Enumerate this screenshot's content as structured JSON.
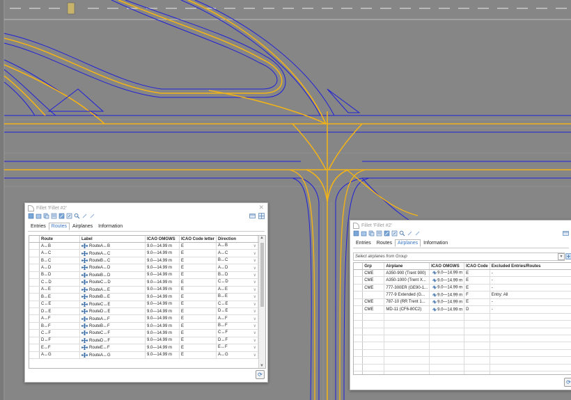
{
  "colors": {
    "background": "#868686",
    "taxiway_centerline": "#f2b318",
    "taxiway_edge": "#1f1fd8",
    "accent": "#3a76c4"
  },
  "dialog_routes": {
    "title": "Fillet 'Fillet #2'",
    "tabs": [
      "Entries",
      "Routes",
      "Airplanes",
      "Information"
    ],
    "active_tab": "Routes",
    "columns": {
      "route": "Route",
      "label": "Label",
      "omgws": "ICAO OMGWS",
      "code": "ICAO Code letter",
      "direction": "Direction"
    },
    "rows": [
      {
        "route": "A↔B",
        "label": "RouteA↔B",
        "omgws": "9.0—14.99 m",
        "code": "E",
        "direction": "A↔B"
      },
      {
        "route": "A↔C",
        "label": "RouteA↔C",
        "omgws": "9.0—14.99 m",
        "code": "E",
        "direction": "A↔C"
      },
      {
        "route": "B↔C",
        "label": "RouteB↔C",
        "omgws": "9.0—14.99 m",
        "code": "E",
        "direction": "B↔C"
      },
      {
        "route": "A↔D",
        "label": "RouteA↔D",
        "omgws": "9.0—14.99 m",
        "code": "E",
        "direction": "A↔D"
      },
      {
        "route": "B↔D",
        "label": "RouteB↔D",
        "omgws": "9.0—14.99 m",
        "code": "E",
        "direction": "B↔D"
      },
      {
        "route": "C↔D",
        "label": "RouteC↔D",
        "omgws": "9.0—14.99 m",
        "code": "E",
        "direction": "C↔D"
      },
      {
        "route": "A↔E",
        "label": "RouteA↔E",
        "omgws": "9.0—14.99 m",
        "code": "E",
        "direction": "A↔E"
      },
      {
        "route": "B↔E",
        "label": "RouteB↔E",
        "omgws": "9.0—14.99 m",
        "code": "E",
        "direction": "B↔E"
      },
      {
        "route": "C↔E",
        "label": "RouteC↔E",
        "omgws": "9.0—14.99 m",
        "code": "E",
        "direction": "C↔E"
      },
      {
        "route": "D↔E",
        "label": "RouteD↔E",
        "omgws": "9.0—14.99 m",
        "code": "E",
        "direction": "D↔E"
      },
      {
        "route": "A↔F",
        "label": "RouteA↔F",
        "omgws": "9.0—14.99 m",
        "code": "E",
        "direction": "A↔F"
      },
      {
        "route": "B↔F",
        "label": "RouteB↔F",
        "omgws": "9.0—14.99 m",
        "code": "E",
        "direction": "B↔F"
      },
      {
        "route": "C↔F",
        "label": "RouteC↔F",
        "omgws": "9.0—14.99 m",
        "code": "E",
        "direction": "C↔F"
      },
      {
        "route": "D↔F",
        "label": "RouteD↔F",
        "omgws": "9.0—14.99 m",
        "code": "E",
        "direction": "D↔F"
      },
      {
        "route": "E↔F",
        "label": "RouteE↔F",
        "omgws": "9.0—14.99 m",
        "code": "E",
        "direction": "E↔F"
      },
      {
        "route": "A↔G",
        "label": "RouteA↔G",
        "omgws": "9.0—14.99 m",
        "code": "E",
        "direction": "A↔G"
      }
    ]
  },
  "dialog_airplanes": {
    "title": "Fillet 'Fillet #2'",
    "tabs": [
      "Entries",
      "Routes",
      "Airplanes",
      "Information"
    ],
    "active_tab": "Airplanes",
    "select_placeholder": "Select airplanes from Group",
    "columns": {
      "grp": "Grp",
      "airplane": "Airplane",
      "omgws": "ICAO OMGWS",
      "code": "ICAO Code",
      "excluded": "Excluded Entries/Routes"
    },
    "rows": [
      {
        "grp": "CME",
        "airplane": "A350-900 (Trent 900)",
        "omgws": "9.0—14.99 m",
        "code": "E",
        "excluded": "-"
      },
      {
        "grp": "CME",
        "airplane": "A350-1000 (Trent X...",
        "omgws": "9.0—14.99 m",
        "code": "E",
        "excluded": "-"
      },
      {
        "grp": "CME",
        "airplane": "777-300ER (GE90-1...",
        "omgws": "9.0—14.99 m",
        "code": "E",
        "excluded": "-"
      },
      {
        "grp": "",
        "airplane": "777-9 Extended (G...",
        "omgws": "9.0—14.99 m",
        "code": "F",
        "excluded": "Entry: All"
      },
      {
        "grp": "CME",
        "airplane": "787-10 (RR Trent 1...",
        "omgws": "9.0—14.99 m",
        "code": "E",
        "excluded": "-"
      },
      {
        "grp": "CME",
        "airplane": "MD-11 (CF6-80C2)",
        "omgws": "9.0—14.99 m",
        "code": "D",
        "excluded": "-"
      }
    ]
  }
}
